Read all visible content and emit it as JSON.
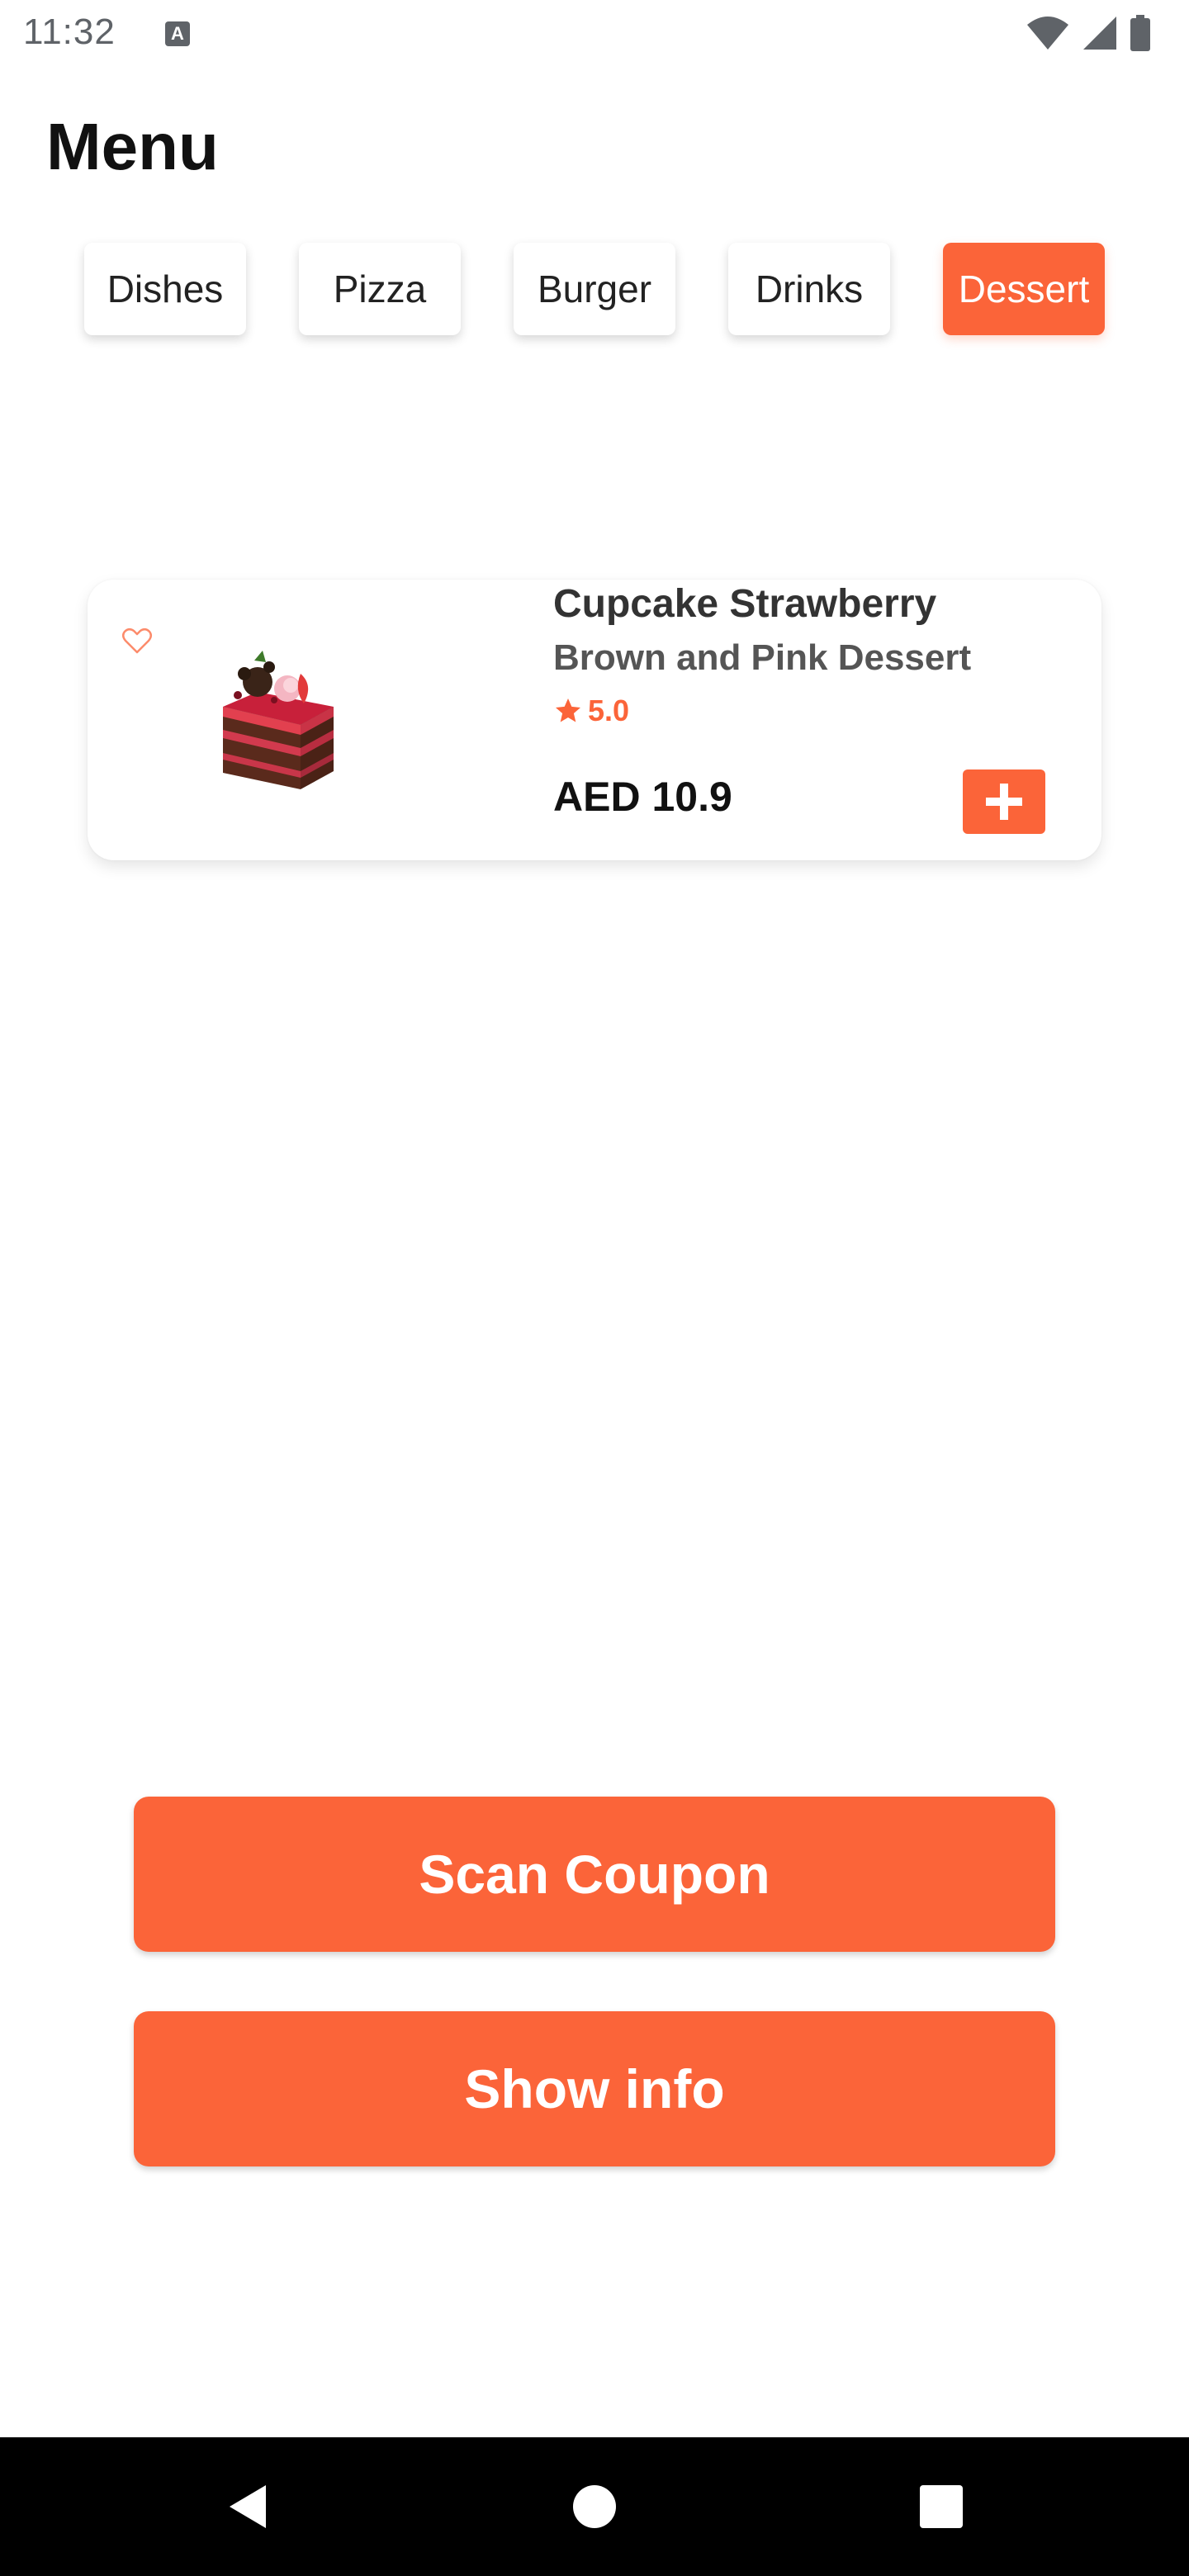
{
  "status_bar": {
    "time": "11:32",
    "notification_icon": "a-icon",
    "icons": [
      "wifi-icon",
      "signal-icon",
      "battery-icon"
    ]
  },
  "page": {
    "title": "Menu"
  },
  "tabs": [
    {
      "label": "Dishes",
      "active": false
    },
    {
      "label": "Pizza",
      "active": false
    },
    {
      "label": "Burger",
      "active": false
    },
    {
      "label": "Drinks",
      "active": false
    },
    {
      "label": "Dessert",
      "active": true
    }
  ],
  "items": [
    {
      "title": "Cupcake Strawberry",
      "subtitle": "Brown and Pink Dessert",
      "rating": "5.0",
      "price": "AED 10.9",
      "favorite_icon": "heart-outline-icon",
      "add_icon": "plus-icon"
    }
  ],
  "buttons": {
    "scan_coupon": "Scan Coupon",
    "show_info": "Show info"
  },
  "nav": {
    "icons": [
      "back-icon",
      "home-icon",
      "recents-icon"
    ]
  },
  "colors": {
    "accent": "#fb6439",
    "text": "#111111",
    "nav_bg": "#000000"
  }
}
